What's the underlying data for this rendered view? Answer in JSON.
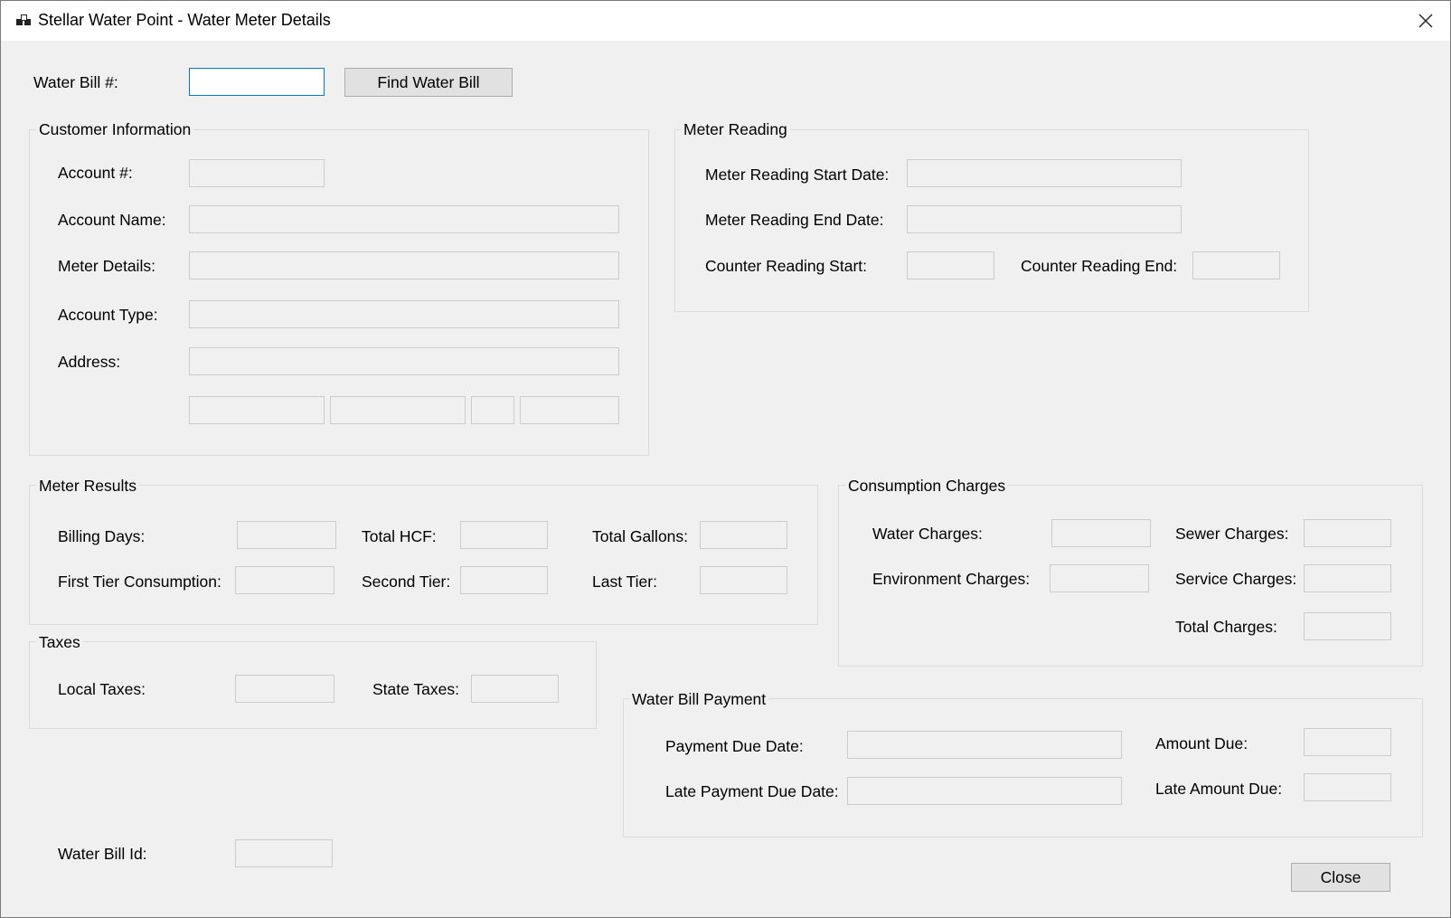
{
  "window": {
    "title": "Stellar Water Point - Water Meter Details"
  },
  "search": {
    "label": "Water Bill #:",
    "value": "",
    "button_label": "Find Water Bill"
  },
  "customer": {
    "group_label": "Customer Information",
    "account_number_label": "Account #:",
    "account_number": "",
    "account_name_label": "Account Name:",
    "account_name": "",
    "meter_details_label": "Meter Details:",
    "meter_details": "",
    "account_type_label": "Account Type:",
    "account_type": "",
    "address_label": "Address:",
    "address": "",
    "city": "",
    "county": "",
    "state": "",
    "zip": ""
  },
  "meter_reading": {
    "group_label": "Meter Reading",
    "start_date_label": "Meter Reading Start Date:",
    "start_date": "",
    "end_date_label": "Meter Reading End Date:",
    "end_date": "",
    "counter_start_label": "Counter Reading Start:",
    "counter_start": "",
    "counter_end_label": "Counter Reading End:",
    "counter_end": ""
  },
  "meter_results": {
    "group_label": "Meter Results",
    "billing_days_label": "Billing Days:",
    "billing_days": "",
    "total_hcf_label": "Total HCF:",
    "total_hcf": "",
    "total_gallons_label": "Total Gallons:",
    "total_gallons": "",
    "first_tier_label": "First Tier Consumption:",
    "first_tier": "",
    "second_tier_label": "Second Tier:",
    "second_tier": "",
    "last_tier_label": "Last Tier:",
    "last_tier": ""
  },
  "consumption": {
    "group_label": "Consumption Charges",
    "water_charges_label": "Water Charges:",
    "water_charges": "",
    "sewer_charges_label": "Sewer Charges:",
    "sewer_charges": "",
    "environment_charges_label": "Environment Charges:",
    "environment_charges": "",
    "service_charges_label": "Service Charges:",
    "service_charges": "",
    "total_charges_label": "Total Charges:",
    "total_charges": ""
  },
  "taxes": {
    "group_label": "Taxes",
    "local_taxes_label": "Local Taxes:",
    "local_taxes": "",
    "state_taxes_label": "State Taxes:",
    "state_taxes": ""
  },
  "payment": {
    "group_label": "Water Bill Payment",
    "due_date_label": "Payment Due Date:",
    "due_date": "",
    "amount_due_label": "Amount Due:",
    "amount_due": "",
    "late_due_date_label": "Late Payment Due Date:",
    "late_due_date": "",
    "late_amount_due_label": "Late Amount Due:",
    "late_amount_due": ""
  },
  "footer": {
    "bill_id_label": "Water Bill Id:",
    "bill_id": "",
    "close_label": "Close"
  },
  "colors": {
    "window_bg": "#f0f0f0",
    "titlebar_bg": "#ffffff",
    "focus_border": "#0078d7",
    "textbox_border": "#cccccc",
    "button_bg": "#e1e1e1",
    "button_border": "#adadad"
  },
  "icons": {
    "app": "app-icon",
    "close": "close-icon"
  }
}
